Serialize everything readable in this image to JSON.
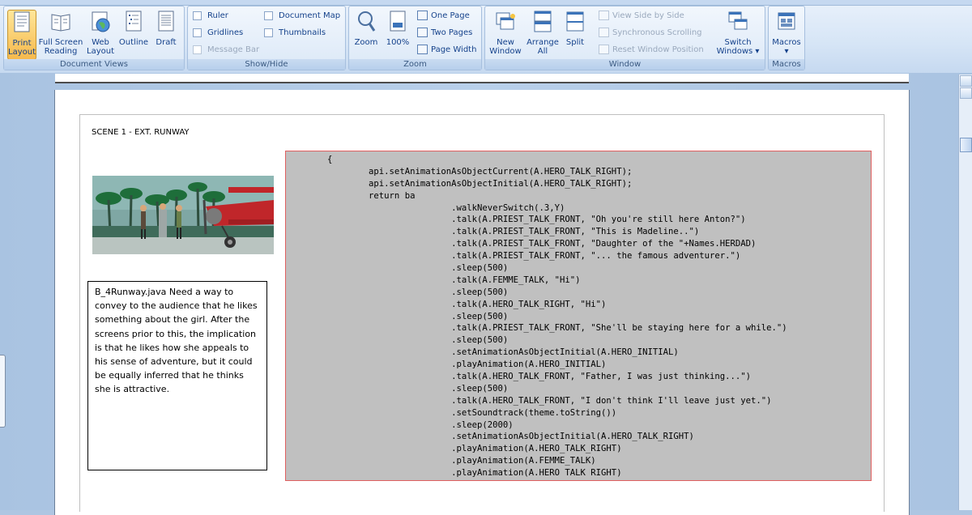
{
  "ribbon": {
    "document_views": {
      "label": "Document Views",
      "buttons": [
        {
          "line1": "Print",
          "line2": "Layout",
          "active": true
        },
        {
          "line1": "Full Screen",
          "line2": "Reading"
        },
        {
          "line1": "Web",
          "line2": "Layout"
        },
        {
          "line1": "Outline",
          "line2": ""
        },
        {
          "line1": "Draft",
          "line2": ""
        }
      ]
    },
    "show_hide": {
      "label": "Show/Hide",
      "ruler": "Ruler",
      "gridlines": "Gridlines",
      "message_bar": "Message Bar",
      "document_map": "Document Map",
      "thumbnails": "Thumbnails"
    },
    "zoom": {
      "label": "Zoom",
      "zoom": "Zoom",
      "percent": "100%",
      "one_page": "One Page",
      "two_pages": "Two Pages",
      "page_width": "Page Width"
    },
    "window": {
      "label": "Window",
      "new_window_1": "New",
      "new_window_2": "Window",
      "arrange_1": "Arrange",
      "arrange_2": "All",
      "split": "Split",
      "view_side": "View Side by Side",
      "sync_scroll": "Synchronous Scrolling",
      "reset_pos": "Reset Window Position",
      "switch_1": "Switch",
      "switch_2": "Windows ▾"
    },
    "macros": {
      "label": "Macros",
      "button": "Macros",
      "arrow": "▾"
    }
  },
  "document": {
    "scene_heading": "SCENE 1 - EXT. RUNWAY",
    "note": "B_4Runway.java Need a way to convey to the audience that he likes something about the girl. After the screens prior to this, the implication is that he likes how she appeals to his sense of adventure, but it could be equally inferred that he thinks she is attractive.",
    "code_lines": [
      "        {",
      "                api.setAnimationAsObjectCurrent(A.HERO_TALK_RIGHT);",
      "                api.setAnimationAsObjectInitial(A.HERO_TALK_RIGHT);",
      "                return ba",
      "                                .walkNeverSwitch(.3,Y)",
      "                                .talk(A.PRIEST_TALK_FRONT, \"Oh you're still here Anton?\")",
      "                                .talk(A.PRIEST_TALK_FRONT, \"This is Madeline..\")",
      "                                .talk(A.PRIEST_TALK_FRONT, \"Daughter of the \"+Names.HERDAD)",
      "                                .talk(A.PRIEST_TALK_FRONT, \"... the famous adventurer.\")",
      "                                .sleep(500)",
      "                                .talk(A.FEMME_TALK, \"Hi\")",
      "                                .sleep(500)",
      "                                .talk(A.HERO_TALK_RIGHT, \"Hi\")",
      "                                .sleep(500)",
      "                                .talk(A.PRIEST_TALK_FRONT, \"She'll be staying here for a while.\")",
      "                                .sleep(500)",
      "                                .setAnimationAsObjectInitial(A.HERO_INITIAL)",
      "                                .playAnimation(A.HERO_INITIAL)",
      "                                .talk(A.HERO_TALK_FRONT, \"Father, I was just thinking...\")",
      "                                .sleep(500)",
      "                                .talk(A.HERO_TALK_FRONT, \"I don't think I'll leave just yet.\")",
      "                                .setSoundtrack(theme.toString())",
      "                                .sleep(2000)",
      "                                .setAnimationAsObjectInitial(A.HERO_TALK_RIGHT)",
      "                                .playAnimation(A.HERO_TALK_RIGHT)",
      "                                .playAnimation(A.FEMME_TALK)",
      "                                .playAnimation(A.HERO TALK RIGHT)"
    ]
  }
}
